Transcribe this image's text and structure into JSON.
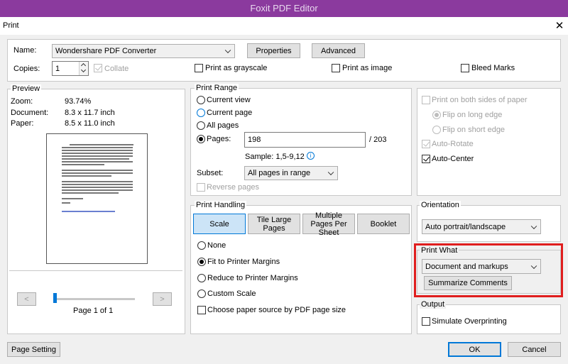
{
  "app_title": "Foxit PDF Editor",
  "dialog_title": "Print",
  "close_symbol": "✕",
  "printer": {
    "name_label": "Name:",
    "name_value": "Wondershare PDF Converter",
    "properties_label": "Properties",
    "advanced_label": "Advanced",
    "copies_label": "Copies:",
    "copies_value": "1",
    "collate_label": "Collate",
    "grayscale_label": "Print as grayscale",
    "image_label": "Print as image",
    "bleed_label": "Bleed Marks"
  },
  "preview": {
    "legend": "Preview",
    "zoom_label": "Zoom:",
    "zoom_value": "93.74%",
    "document_label": "Document:",
    "document_value": "8.3 x 11.7 inch",
    "paper_label": "Paper:",
    "paper_value": "8.5 x 11.0 inch",
    "prev_symbol": "<",
    "next_symbol": ">",
    "page_indicator": "Page 1 of 1"
  },
  "print_range": {
    "legend": "Print Range",
    "current_view": "Current view",
    "current_page": "Current page",
    "all_pages": "All pages",
    "pages_label": "Pages:",
    "pages_value": "198",
    "total_pages": "/ 203",
    "sample": "Sample: 1,5-9,12",
    "info_symbol": "i",
    "subset_label": "Subset:",
    "subset_value": "All pages in range",
    "reverse_label": "Reverse pages"
  },
  "print_handling": {
    "legend": "Print Handling",
    "tabs": [
      "Scale",
      "Tile Large Pages",
      "Multiple Pages Per Sheet",
      "Booklet"
    ],
    "none_label": "None",
    "fit_label": "Fit to Printer Margins",
    "reduce_label": "Reduce to Printer Margins",
    "custom_label": "Custom Scale",
    "paper_source_label": "Choose paper source by PDF page size"
  },
  "right_options": {
    "both_sides": "Print on both sides of paper",
    "flip_long": "Flip on long edge",
    "flip_short": "Flip on short edge",
    "auto_rotate": "Auto-Rotate",
    "auto_center": "Auto-Center"
  },
  "orientation": {
    "legend": "Orientation",
    "value": "Auto portrait/landscape"
  },
  "print_what": {
    "legend": "Print What",
    "value": "Document and markups",
    "summarize_label": "Summarize Comments"
  },
  "output": {
    "legend": "Output",
    "simulate_label": "Simulate Overprinting"
  },
  "footer": {
    "page_setting_label": "Page Setting",
    "ok_label": "OK",
    "cancel_label": "Cancel"
  },
  "colors": {
    "titlebar": "#8b3a9e",
    "highlight": "#e01e1e",
    "accent": "#0078d7"
  }
}
